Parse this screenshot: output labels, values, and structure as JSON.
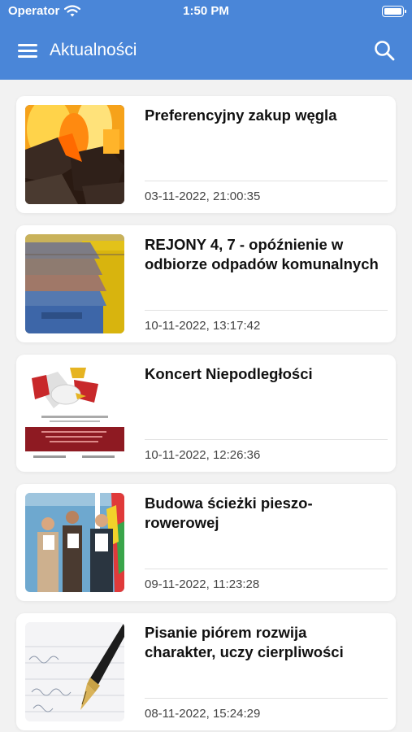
{
  "status_bar": {
    "carrier": "Operator",
    "time": "1:50 PM"
  },
  "header": {
    "title": "Aktualności",
    "menu_icon": "hamburger-menu-icon",
    "search_icon": "search-icon",
    "color": "#4a86d8"
  },
  "news": [
    {
      "title": "Preferencyjny zakup węgla",
      "date": "03-11-2022, 21:00:35",
      "image": "burning-coal"
    },
    {
      "title": "REJONY 4, 7 - opóźnienie w odbiorze odpadów komunalnych",
      "date": "10-11-2022, 13:17:42",
      "image": "waste-bins"
    },
    {
      "title": "Koncert Niepodległości",
      "date": "10-11-2022, 12:26:36",
      "image": "concert-poster"
    },
    {
      "title": "Budowa ścieżki pieszo-rowerowej",
      "date": "09-11-2022, 11:23:28",
      "image": "people-with-documents"
    },
    {
      "title": "Pisanie piórem rozwija charakter, uczy cierpliwości",
      "date": "08-11-2022, 15:24:29",
      "image": "fountain-pen"
    }
  ]
}
